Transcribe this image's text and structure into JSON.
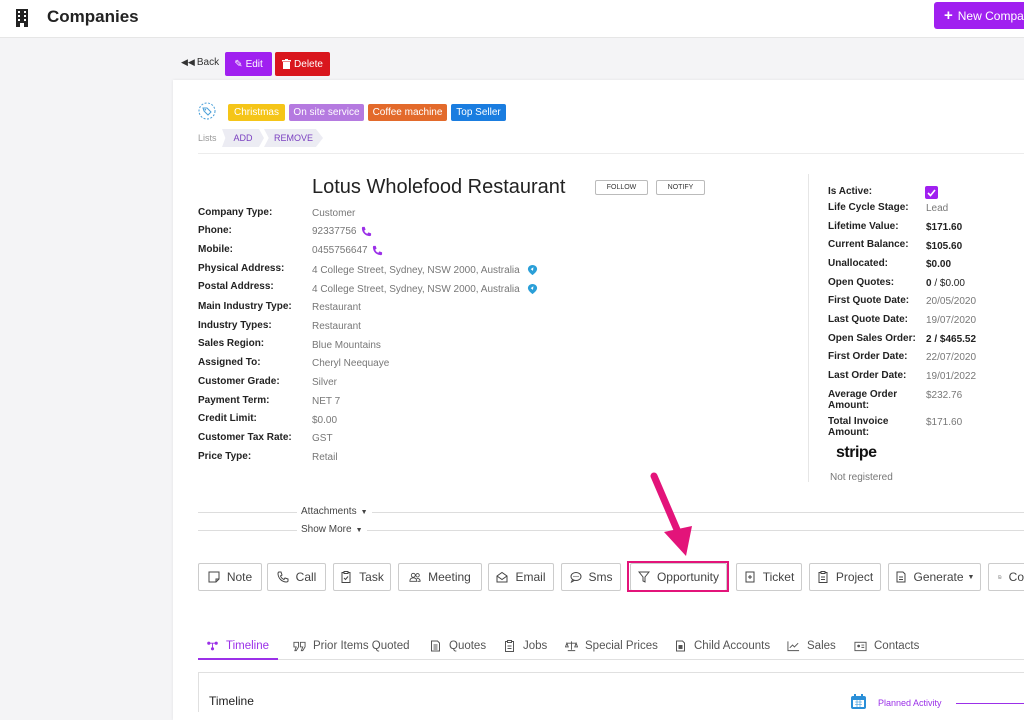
{
  "header": {
    "title": "Companies",
    "new_button": "New Companies",
    "icon": "building-icon",
    "accent": "#a020f0"
  },
  "actions": {
    "back": "Back",
    "edit": "Edit",
    "delete": "Delete"
  },
  "tags": [
    {
      "label": "Christmas",
      "color": "#f5c518"
    },
    {
      "label": "On site service",
      "color": "#b57ae0"
    },
    {
      "label": "Coffee machine",
      "color": "#e36a2b"
    },
    {
      "label": "Top Seller",
      "color": "#1a7de0"
    }
  ],
  "lists": {
    "label": "Lists",
    "add": "ADD",
    "remove": "REMOVE"
  },
  "company": {
    "name": "Lotus Wholefood Restaurant",
    "follow": "FOLLOW",
    "notify": "NOTIFY"
  },
  "fields": [
    {
      "label": "Company Type:",
      "value": "Customer"
    },
    {
      "label": "Phone:",
      "value": "92337756",
      "icon": "phone-icon"
    },
    {
      "label": "Mobile:",
      "value": "0455756647",
      "icon": "phone-icon"
    },
    {
      "label": "Physical Address:",
      "value": "4 College Street, Sydney, NSW 2000, Australia",
      "icon": "map-pin-icon"
    },
    {
      "label": "Postal Address:",
      "value": "4 College Street, Sydney, NSW 2000, Australia",
      "icon": "map-pin-icon"
    },
    {
      "label": "Main Industry Type:",
      "value": "Restaurant"
    },
    {
      "label": "Industry Types:",
      "value": "Restaurant"
    },
    {
      "label": "Sales Region:",
      "value": "Blue Mountains"
    },
    {
      "label": "Assigned To:",
      "value": "Cheryl Neequaye"
    },
    {
      "label": "Customer Grade:",
      "value": "Silver"
    },
    {
      "label": "Payment Term:",
      "value": "NET 7"
    },
    {
      "label": "Credit Limit:",
      "value": "$0.00"
    },
    {
      "label": "Customer Tax Rate:",
      "value": "GST"
    },
    {
      "label": "Price Type:",
      "value": "Retail"
    }
  ],
  "summary": {
    "is_active": "Is Active:",
    "life_cycle_label": "Life Cycle Stage:",
    "life_cycle": "Lead",
    "lifetime_label": "Lifetime Value:",
    "lifetime": "$171.60",
    "balance_label": "Current Balance:",
    "balance": "$105.60",
    "unallocated_label": "Unallocated:",
    "unallocated": "$0.00",
    "open_quotes_label": "Open Quotes:",
    "open_quotes_count": "0",
    "open_quotes_amount": " / $0.00",
    "first_quote_label": "First Quote Date:",
    "first_quote": "20/05/2020",
    "last_quote_label": "Last Quote Date:",
    "last_quote": "19/07/2020",
    "open_sales_label": "Open Sales Order:",
    "open_sales_count": "2",
    "open_sales_amount": " / $465.52",
    "first_order_label": "First Order Date:",
    "first_order": "22/07/2020",
    "last_order_label": "Last Order Date:",
    "last_order": "19/01/2022",
    "avg_order_label_1": "Average Order",
    "avg_order_label_2": "Amount:",
    "avg_order": "$232.76",
    "total_invoice_label_1": "Total Invoice",
    "total_invoice_label_2": "Amount:",
    "total_invoice": "$171.60",
    "stripe": "stripe",
    "stripe_status": "Not registered"
  },
  "toggles": {
    "attachments": "Attachments",
    "show_more": "Show More"
  },
  "activity_buttons": [
    {
      "label": "Note",
      "icon": "note-icon"
    },
    {
      "label": "Call",
      "icon": "phone-icon"
    },
    {
      "label": "Task",
      "icon": "clipboard-check-icon"
    },
    {
      "label": "Meeting",
      "icon": "users-icon"
    },
    {
      "label": "Email",
      "icon": "envelope-icon"
    },
    {
      "label": "Sms",
      "icon": "chat-icon"
    },
    {
      "label": "Opportunity",
      "icon": "filter-icon"
    },
    {
      "label": "Ticket",
      "icon": "ticket-icon"
    },
    {
      "label": "Project",
      "icon": "clipboard-icon"
    },
    {
      "label": "Generate",
      "icon": "document-icon"
    },
    {
      "label": "Co",
      "icon": "document-icon"
    }
  ],
  "highlight_color": "#e3147a",
  "tabs": [
    {
      "label": "Timeline",
      "icon": "timeline-icon"
    },
    {
      "label": "Prior Items Quoted",
      "icon": "quote-icon"
    },
    {
      "label": "Quotes",
      "icon": "document-icon"
    },
    {
      "label": "Jobs",
      "icon": "clipboard-icon"
    },
    {
      "label": "Special Prices",
      "icon": "scale-icon"
    },
    {
      "label": "Child Accounts",
      "icon": "document-icon"
    },
    {
      "label": "Sales",
      "icon": "chart-line-icon"
    },
    {
      "label": "Contacts",
      "icon": "contact-card-icon"
    }
  ],
  "timeline": {
    "title": "Timeline",
    "planned": "Planned Activity"
  }
}
